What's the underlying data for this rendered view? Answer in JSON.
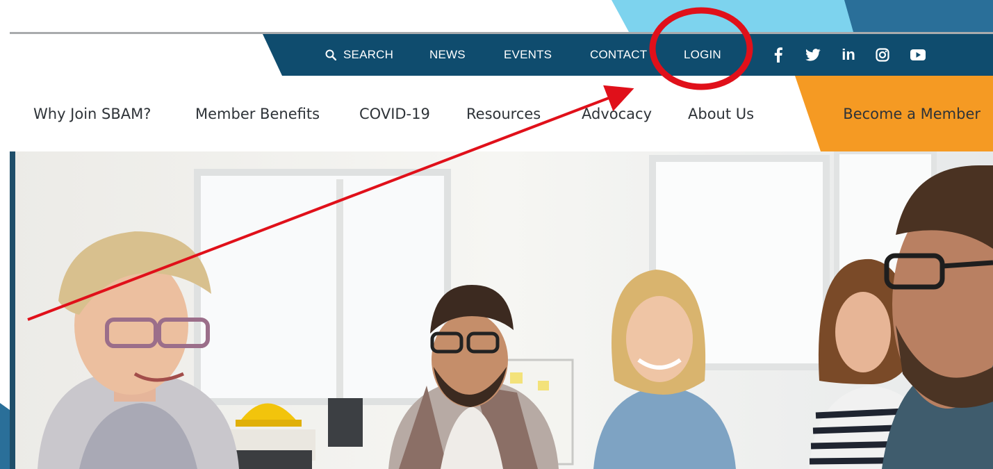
{
  "utility_nav": {
    "search_label": "SEARCH",
    "news_label": "NEWS",
    "events_label": "EVENTS",
    "contact_label": "CONTACT",
    "login_label": "LOGIN",
    "social": [
      "facebook-icon",
      "twitter-icon",
      "linkedin-icon",
      "instagram-icon",
      "youtube-icon"
    ],
    "linkedin_text": "in"
  },
  "main_nav": {
    "items": [
      {
        "label": "Why Join SBAM?"
      },
      {
        "label": "Member Benefits"
      },
      {
        "label": "COVID-19"
      },
      {
        "label": "Resources"
      },
      {
        "label": "Advocacy"
      },
      {
        "label": "About Us"
      }
    ],
    "cta_label": "Become a Member"
  },
  "colors": {
    "utility_bar": "#0f4c6e",
    "cta_orange": "#f59a23",
    "nav_text": "#2e3338",
    "annotation_red": "#e0101a",
    "slide_light_blue": "#7dd3ee",
    "slide_dark_blue": "#2a6f99"
  }
}
